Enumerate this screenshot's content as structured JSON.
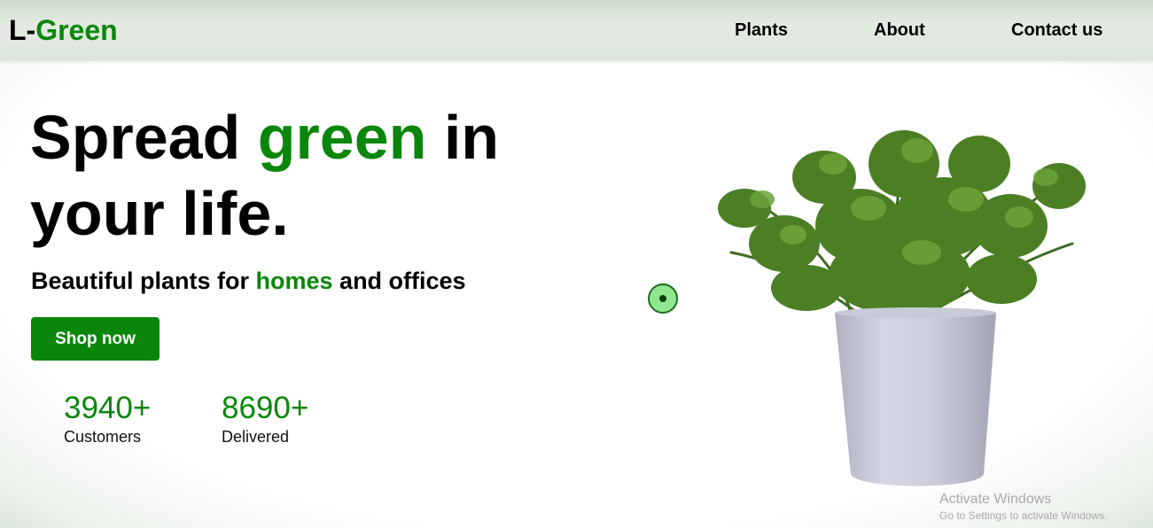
{
  "header": {
    "logo_prefix": "L-",
    "logo_accent": "Green",
    "nav": [
      {
        "label": "Plants"
      },
      {
        "label": "About"
      },
      {
        "label": "Contact us"
      }
    ]
  },
  "hero": {
    "title_part1": "Spread ",
    "title_accent": "green",
    "title_part2": " in your life.",
    "subtitle_part1": "Beautiful plants for ",
    "subtitle_accent": "homes",
    "subtitle_part2": " and offices",
    "cta_label": "Shop now",
    "stats": [
      {
        "value": "3940+",
        "label": "Customers"
      },
      {
        "value": "8690+",
        "label": "Delivered"
      }
    ]
  },
  "windows_watermark": {
    "title": "Activate Windows",
    "subtitle": "Go to Settings to activate Windows."
  },
  "theme": {
    "accent": "#0a870a",
    "cta_text": "#ffffff",
    "nav_bg": "#dde6dc"
  },
  "icons": {
    "cursor": "green-circle-cursor",
    "hero_image": "potted-plant-image"
  }
}
